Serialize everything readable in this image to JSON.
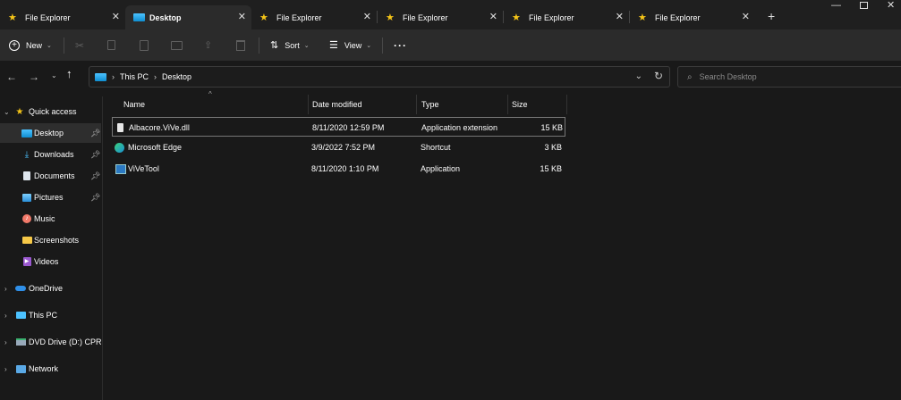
{
  "tabs": [
    {
      "label": "File Explorer",
      "icon": "star-icon",
      "active": false
    },
    {
      "label": "Desktop",
      "icon": "desktop-icon",
      "active": true
    },
    {
      "label": "File Explorer",
      "icon": "star-icon",
      "active": false
    },
    {
      "label": "File Explorer",
      "icon": "star-icon",
      "active": false
    },
    {
      "label": "File Explorer",
      "icon": "star-icon",
      "active": false
    },
    {
      "label": "File Explorer",
      "icon": "star-icon",
      "active": false
    }
  ],
  "toolbar": {
    "new_label": "New",
    "sort_label": "Sort",
    "view_label": "View"
  },
  "address": {
    "breadcrumb": [
      "This PC",
      "Desktop"
    ],
    "search_placeholder": "Search Desktop"
  },
  "nav": {
    "quick_access": "Quick access",
    "items": [
      {
        "label": "Desktop",
        "icon": "desktop-icon",
        "pinned": true
      },
      {
        "label": "Downloads",
        "icon": "download-icon",
        "pinned": true
      },
      {
        "label": "Documents",
        "icon": "document-icon",
        "pinned": true
      },
      {
        "label": "Pictures",
        "icon": "picture-icon",
        "pinned": true
      },
      {
        "label": "Music",
        "icon": "music-icon",
        "pinned": false
      },
      {
        "label": "Screenshots",
        "icon": "folder-icon",
        "pinned": false
      },
      {
        "label": "Videos",
        "icon": "video-icon",
        "pinned": false
      }
    ],
    "roots": [
      {
        "label": "OneDrive",
        "icon": "cloud-icon"
      },
      {
        "label": "This PC",
        "icon": "computer-icon"
      },
      {
        "label": "DVD Drive (D:) CPRA",
        "icon": "dvd-drive-icon"
      },
      {
        "label": "Network",
        "icon": "network-icon"
      }
    ]
  },
  "columns": [
    "Name",
    "Date modified",
    "Type",
    "Size"
  ],
  "files": [
    {
      "name": "Albacore.ViVe.dll",
      "date": "8/11/2020 12:59 PM",
      "type": "Application extension",
      "size": "15 KB",
      "icon": "dll-file-icon"
    },
    {
      "name": "Microsoft Edge",
      "date": "3/9/2022 7:52 PM",
      "type": "Shortcut",
      "size": "3 KB",
      "icon": "edge-icon"
    },
    {
      "name": "ViVeTool",
      "date": "8/11/2020 1:10 PM",
      "type": "Application",
      "size": "15 KB",
      "icon": "app-icon"
    }
  ],
  "colors": {
    "accent": "#4cc2ff",
    "star": "#f5c518",
    "background": "#191919"
  }
}
